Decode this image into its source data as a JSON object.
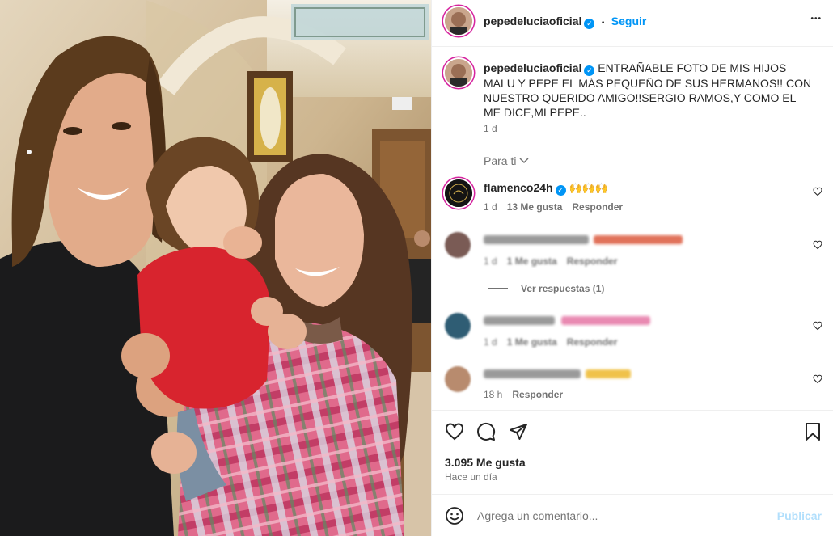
{
  "header": {
    "username": "pepedeluciaoficial",
    "verified_mark": "✓",
    "dot": "•",
    "follow_label": "Seguir",
    "more_label": "•••"
  },
  "caption": {
    "username": "pepedeluciaoficial",
    "text": "ENTRAÑABLE FOTO DE MIS HIJOS MALU Y PEPE EL MÁS PEQUEÑO DE SUS HERMANOS!! CON NUESTRO QUERIDO AMIGO!!SERGIO RAMOS,Y COMO EL ME DICE,MI PEPE..",
    "time": "1 d"
  },
  "filter": {
    "label": "Para ti",
    "icon": "chevron-down-icon"
  },
  "comments": [
    {
      "username": "flamenco24h",
      "emoji": "🙌🙌🙌",
      "time": "1 d",
      "likes": "13 Me gusta",
      "reply_label": "Responder"
    },
    {
      "username_blurred": "",
      "time": "1 d",
      "likes": "1 Me gusta",
      "reply_label": "Responder",
      "view_replies": "Ver respuestas (1)"
    },
    {
      "username_blurred": "",
      "time": "1 d",
      "likes": "1 Me gusta",
      "reply_label": "Responder"
    },
    {
      "username_blurred": "",
      "time": "18 h",
      "reply_label": "Responder"
    }
  ],
  "actions": {
    "like_icon": "heart-icon",
    "comment_icon": "comment-icon",
    "share_icon": "share-icon",
    "save_icon": "bookmark-icon"
  },
  "stats": {
    "likes": "3.095 Me gusta",
    "date": "Hace un día"
  },
  "composer": {
    "placeholder": "Agrega un comentario...",
    "publish_label": "Publicar",
    "emoji_icon": "smiley-icon"
  },
  "colors": {
    "accent": "#0095f6",
    "text": "#262626",
    "muted": "#737373",
    "publish_disabled": "#b2dffc",
    "ring": "#d6249f"
  }
}
